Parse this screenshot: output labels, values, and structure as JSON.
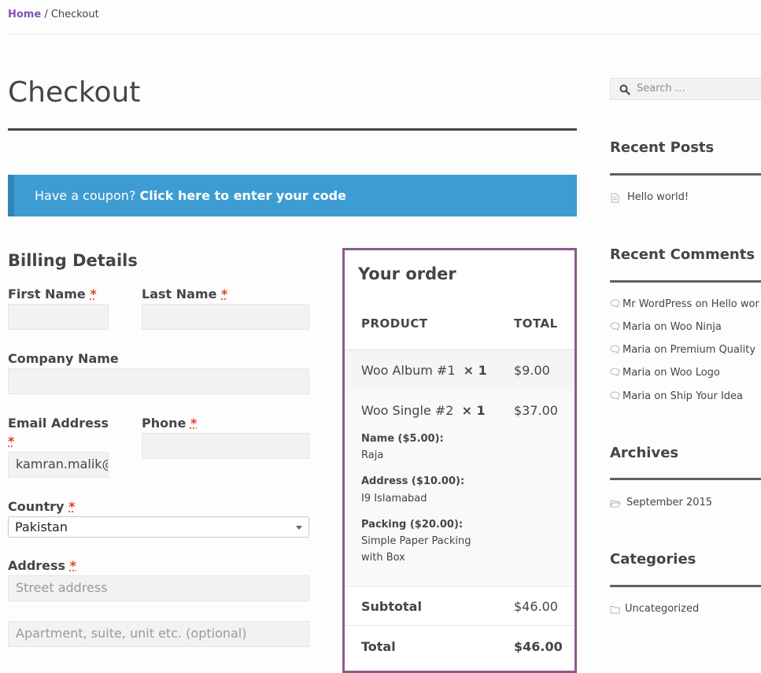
{
  "breadcrumb": {
    "home": "Home",
    "separator": " / ",
    "current": "Checkout"
  },
  "page_title": "Checkout",
  "coupon": {
    "text": "Have a coupon?",
    "link": "Click here to enter your code"
  },
  "billing": {
    "heading": "Billing Details",
    "required_mark": "*",
    "first_name": {
      "label": "First Name",
      "value": ""
    },
    "last_name": {
      "label": "Last Name",
      "value": ""
    },
    "company": {
      "label": "Company Name",
      "value": ""
    },
    "email": {
      "label": "Email Address",
      "value": "kamran.malik@"
    },
    "phone": {
      "label": "Phone",
      "value": ""
    },
    "country": {
      "label": "Country",
      "selected": "Pakistan"
    },
    "address": {
      "label": "Address",
      "placeholder1": "Street address",
      "placeholder2": "Apartment, suite, unit etc. (optional)"
    }
  },
  "order": {
    "heading": "Your order",
    "col_product": "PRODUCT",
    "col_total": "TOTAL",
    "items": [
      {
        "name": "Woo Album #1",
        "qty": "× 1",
        "price": "$9.00"
      },
      {
        "name": "Woo Single #2",
        "qty": "× 1",
        "price": "$37.00",
        "meta": [
          {
            "key": "Name ($5.00):",
            "value": "Raja"
          },
          {
            "key": "Address ($10.00):",
            "value": "I9 Islamabad"
          },
          {
            "key": "Packing ($20.00):",
            "value": "Simple Paper Packing with Box"
          }
        ]
      }
    ],
    "subtotal_label": "Subtotal",
    "subtotal": "$46.00",
    "total_label": "Total",
    "total": "$46.00"
  },
  "sidebar": {
    "search_placeholder": "Search …",
    "recent_posts": {
      "heading": "Recent Posts",
      "items": [
        "Hello world!"
      ]
    },
    "recent_comments": {
      "heading": "Recent Comments",
      "items": [
        {
          "author": "Mr WordPress",
          "on": " on ",
          "post": "Hello wor"
        },
        {
          "author": "Maria",
          "on": " on ",
          "post": "Woo Ninja"
        },
        {
          "author": "Maria",
          "on": " on ",
          "post": "Premium Quality"
        },
        {
          "author": "Maria",
          "on": " on ",
          "post": "Woo Logo"
        },
        {
          "author": "Maria",
          "on": " on ",
          "post": "Ship Your Idea"
        }
      ]
    },
    "archives": {
      "heading": "Archives",
      "items": [
        "September 2015"
      ]
    },
    "categories": {
      "heading": "Categories",
      "items": [
        "Uncategorized"
      ]
    }
  },
  "colors": {
    "accent": "#7f54b3",
    "coupon_bg": "#3d9cd2",
    "order_border": "#8c5a8a",
    "required": "#e2401c"
  }
}
